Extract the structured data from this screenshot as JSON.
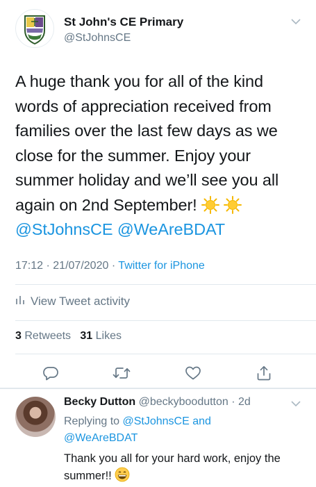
{
  "tweet": {
    "author_name": "St John's CE Primary",
    "author_handle": "@StJohnsCE",
    "text_lines": [
      "A huge thank you for all of the kind",
      "words of appreciation received from",
      "families over the last few days as we",
      "close for the summer. Enjoy your",
      "summer holiday and we’ll see you all",
      "again on 2nd September!"
    ],
    "mentions": [
      "@StJohnsCE",
      "@WeAreBDAT"
    ],
    "time": "17:12",
    "date": "21/07/2020",
    "separator": "·",
    "source": "Twitter for iPhone",
    "activity_label": "View Tweet activity",
    "retweets_count": "3",
    "retweets_label": "Retweets",
    "likes_count": "31",
    "likes_label": "Likes"
  },
  "reply": {
    "author_name": "Becky Dutton",
    "author_handle": "@beckyboodutton",
    "age": "2d",
    "replying_to_prefix": "Replying to",
    "replying_to_1": "@StJohnsCE",
    "replying_and": "and",
    "replying_to_2": "@WeAreBDAT",
    "text_line1": "Thank you all for your hard work, enjoy the",
    "text_line2": "summer!!"
  },
  "icons": [
    "chevron-down-icon",
    "sun-emoji",
    "bar-chart-icon",
    "reply-icon",
    "retweet-icon",
    "like-icon",
    "share-icon",
    "grinning-emoji"
  ],
  "colors": {
    "link": "#1b95e0",
    "muted": "#657786",
    "text": "#14171a",
    "divider": "#e1e8ed"
  }
}
